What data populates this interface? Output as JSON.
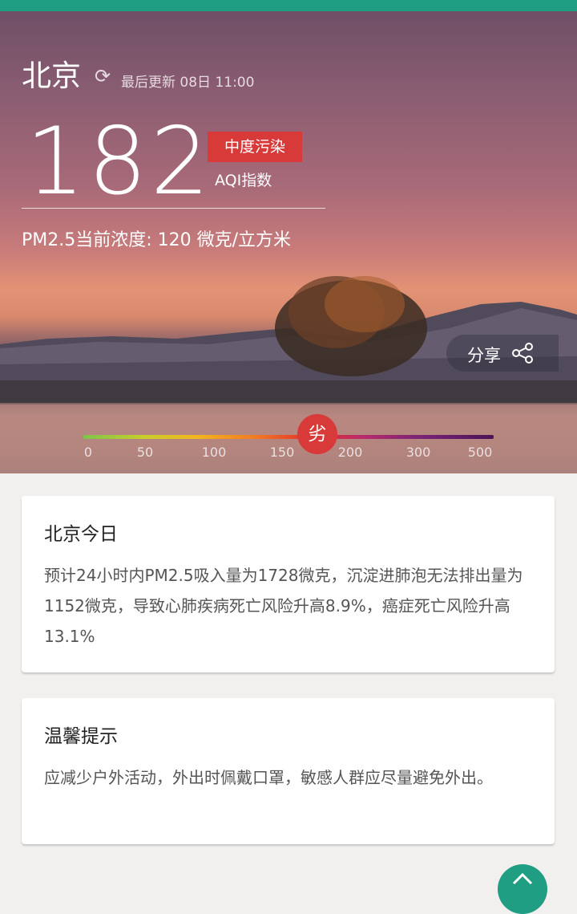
{
  "city": "北京",
  "update_text": "最后更新 08日 11:00",
  "aqi_value": "182",
  "pollution_level": "中度污染",
  "aqi_label": "AQI指数",
  "pm25_text": "PM2.5当前浓度: 120 微克/立方米",
  "share_label": "分享",
  "scale": {
    "ticks": [
      "0",
      "50",
      "100",
      "150",
      "200",
      "300",
      "500"
    ],
    "marker_label": "劣",
    "marker_value": 182
  },
  "cards": [
    {
      "title": "北京今日",
      "body": "预计24小时内PM2.5吸入量为1728微克，沉淀进肺泡无法排出量为1152微克，导致心肺疾病死亡风险升高8.9%，癌症死亡风险升高13.1%"
    },
    {
      "title": "温馨提示",
      "body": "应减少户外活动，外出时佩戴口罩，敏感人群应尽量避免外出。"
    }
  ],
  "colors": {
    "accent": "#1f9e83",
    "alert": "#d83a3a"
  },
  "icons": {
    "refresh": "refresh-icon",
    "share": "share-icon",
    "scroll_top": "chevron-up-icon"
  }
}
